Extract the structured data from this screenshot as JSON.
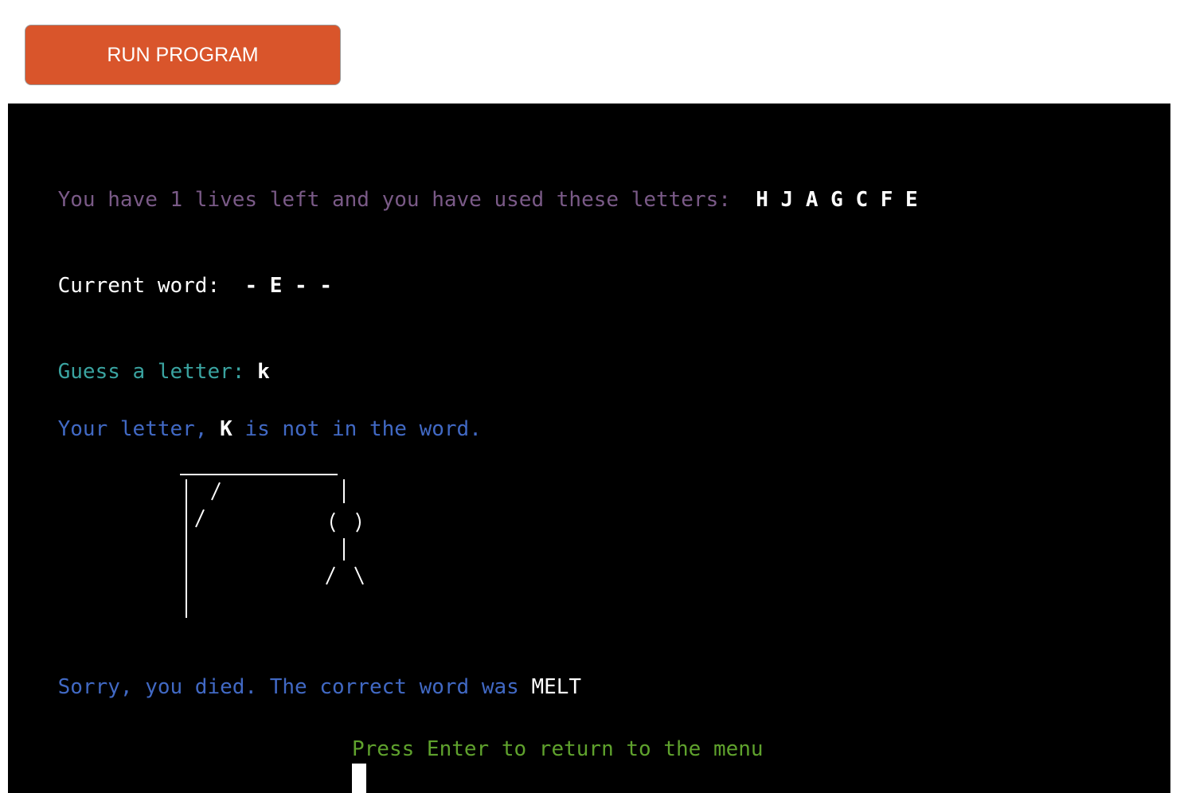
{
  "toolbar": {
    "run_label": "RUN PROGRAM"
  },
  "terminal": {
    "lives_prefix": "You have 1 lives left and you have used these letters:",
    "used_letters": "H J A G C F E",
    "current_word_label": "Current word:",
    "current_word": "- E - -",
    "guess_prompt": "Guess a letter:",
    "guess_input": "k",
    "result_prefix": "Your letter,",
    "result_letter": "K",
    "result_suffix": "is not in the word.",
    "died_text": "Sorry, you died. The correct word was",
    "correct_word": "MELT",
    "return_prompt": "Press Enter to return to the menu"
  },
  "colors": {
    "button": "#d9552b",
    "purple": "#7a5a87",
    "teal": "#3aa3a0",
    "blue": "#4169c4",
    "green": "#5fa22d"
  }
}
